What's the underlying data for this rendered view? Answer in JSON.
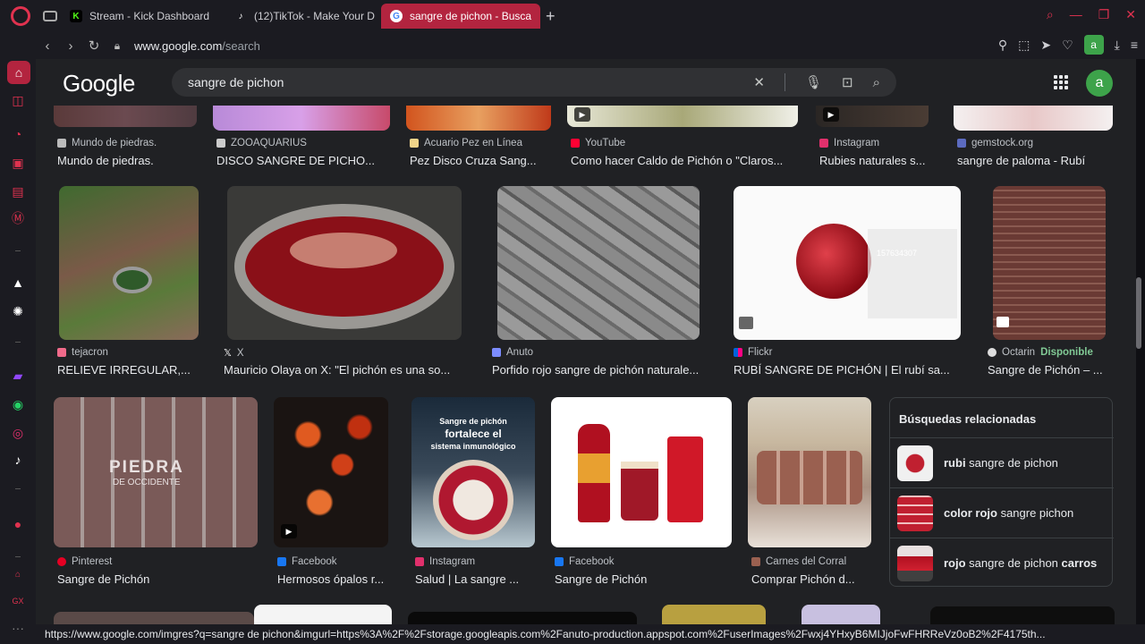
{
  "browser": {
    "tabs": [
      {
        "label": "Stream - Kick Dashboard",
        "fav": "K",
        "fav_color": "#53fc18"
      },
      {
        "label": "(12)TikTok - Make Your D",
        "fav": "♪",
        "fav_color": "#ffffff"
      },
      {
        "label": "sangre de pichon - Busca",
        "fav": "G",
        "fav_color": "#ffffff"
      }
    ],
    "url_host": "www.google.com",
    "url_path": "/search",
    "account_letter": "a"
  },
  "google": {
    "logo": "Google",
    "query": "sangre de pichon",
    "avatar": "a"
  },
  "results": [
    {
      "source": "Mundo de piedras.",
      "title": "Mundo de piedras."
    },
    {
      "source": "ZOOAQUARIUS",
      "title": "DISCO SANGRE DE PICHO..."
    },
    {
      "source": "Acuario Pez en Línea",
      "title": "Pez Disco Cruza Sang..."
    },
    {
      "source": "YouTube",
      "title": "Como hacer Caldo de Pichón o \"Claros..."
    },
    {
      "source": "Instagram",
      "title": "Rubies naturales s..."
    },
    {
      "source": "gemstock.org",
      "title": "sangre de paloma - Rubí"
    },
    {
      "source": "tejacron",
      "title": "RELIEVE IRREGULAR,..."
    },
    {
      "source": "X",
      "title": "Mauricio Olaya on X: \"El pichón es una so..."
    },
    {
      "source": "Anuto",
      "title": "Porfido rojo sangre de pichón naturale..."
    },
    {
      "source": "Flickr",
      "title": "RUBÍ SANGRE DE PICHÓN | El rubí sa..."
    },
    {
      "source": "Octarin",
      "available": "Disponible",
      "title": "Sangre de Pichón – ..."
    },
    {
      "source": "Pinterest",
      "title": "Sangre de Pichón"
    },
    {
      "source": "Facebook",
      "title": "Hermosos ópalos r..."
    },
    {
      "source": "Instagram",
      "title": "Salud | La sangre ..."
    },
    {
      "source": "Facebook",
      "title": "Sangre de Pichón"
    },
    {
      "source": "Carnes del Corral",
      "title": "Comprar Pichón d..."
    }
  ],
  "image_text": {
    "piedra": "PIEDRA",
    "piedra_sub": "DE OCCIDENTE",
    "salud_1": "Sangre de pichón",
    "salud_2": "fortalece el",
    "salud_3": "sistema inmunológico",
    "ruby_id": "157634307"
  },
  "related": {
    "title": "Búsquedas relacionadas",
    "items": [
      {
        "bold_pre": "rubi",
        "normal": " sangre de pichon",
        "bold_post": ""
      },
      {
        "bold_pre": "color rojo",
        "normal": " sangre pichon",
        "bold_post": ""
      },
      {
        "bold_pre": "rojo",
        "normal": " sangre de pichon ",
        "bold_post": "carros"
      }
    ]
  },
  "status_url": "https://www.google.com/imgres?q=sangre de pichon&imgurl=https%3A%2F%2Fstorage.googleapis.com%2Fanuto-production.appspot.com%2FuserImages%2Fwxj4YHxyB6MIJjoFwFHRReVz0oB2%2F4175th..."
}
